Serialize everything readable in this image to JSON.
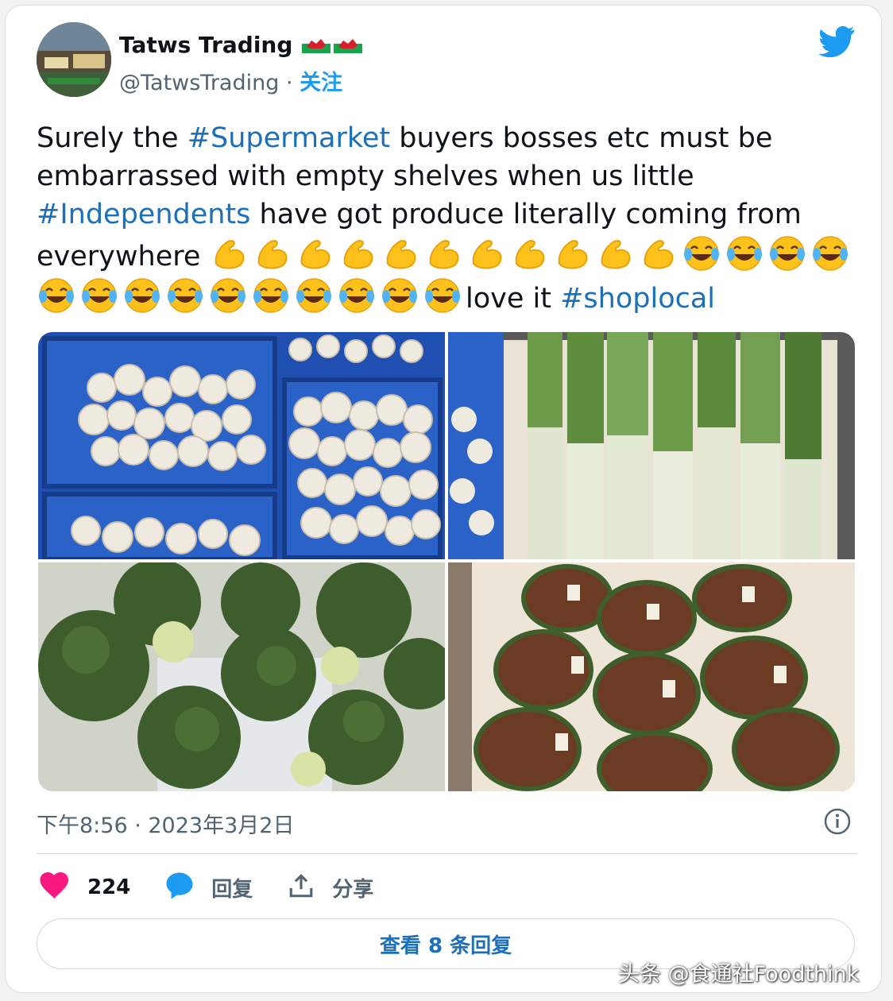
{
  "tweet": {
    "display_name": "Tatws Trading",
    "handle": "@TatwsTrading",
    "separator": " · ",
    "follow_label": "关注",
    "text_parts": [
      "Surely the ",
      "#Supermarket",
      " buyers bosses etc must be embarrassed with empty shelves when us little ",
      "#Independents",
      " have got produce literally coming from everywhere ",
      "love it ",
      "#shoplocal"
    ],
    "emoji": [
      {
        "name": "flexed-biceps",
        "count": 11
      },
      {
        "name": "face-with-tears-of-joy",
        "count": 14
      }
    ],
    "photos": [
      {
        "name": "mushrooms-photo"
      },
      {
        "name": "leeks-photo"
      },
      {
        "name": "broccoli-photo"
      },
      {
        "name": "tomatoes-photo"
      }
    ],
    "timestamp": "下午8:56 · 2023年3月2日",
    "actions": {
      "likes": "224",
      "reply_label": "回复",
      "share_label": "分享"
    },
    "view_replies_label": "查看 8 条回复"
  },
  "icons": {
    "twitter_logo": "twitter-bird-icon",
    "flag": "wales-flag-icon",
    "like": "heart-icon",
    "reply": "speech-bubble-icon",
    "share": "share-upload-icon",
    "info": "info-icon"
  },
  "colors": {
    "accent": "#1d9bf0",
    "hashtag": "#1d6fb8",
    "like": "#f91880",
    "secondary_text": "#536471"
  },
  "watermark": "头条 @食通社Foodthink"
}
